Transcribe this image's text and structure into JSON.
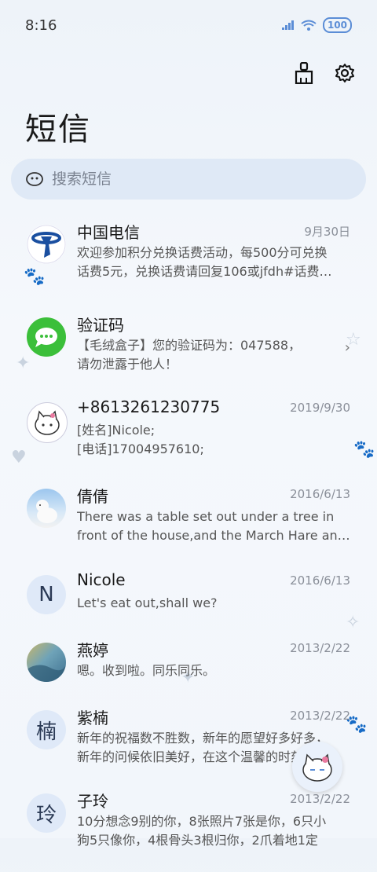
{
  "status_bar": {
    "time": "8:16",
    "battery": "100"
  },
  "header": {
    "title": "短信"
  },
  "search": {
    "placeholder": "搜索短信"
  },
  "conversations": [
    {
      "name": "中国电信",
      "date": "9月30日",
      "line1": "欢迎参加积分兑换话费活动，每500分可兑换",
      "line2": "话费5元，兑换话费请回复106或jfdh#话费…",
      "avatar_icon": "china-telecom-logo"
    },
    {
      "name": "验证码",
      "date": "",
      "line1": "【毛绒盒子】您的验证码为：047588，",
      "line2": "请勿泄露于他人！",
      "avatar_icon": "message-bubble-icon"
    },
    {
      "name": "+8613261230775",
      "date": "2019/9/30",
      "line1": "[姓名]Nicole;",
      "line2": "[电话]17004957610;",
      "avatar_icon": "cat-sticker"
    },
    {
      "name": "倩倩",
      "date": "2016/6/13",
      "line1": "There was a table set out under a tree in",
      "line2": "front of the house,and the March Hare an…",
      "avatar_icon": "polar-bear-photo"
    },
    {
      "name": "Nicole",
      "date": "2016/6/13",
      "line1": "Let's eat out,shall we?",
      "line2": "",
      "avatar_letter": "N"
    },
    {
      "name": "燕婷",
      "date": "2013/2/22",
      "line1": "嗯。收到啦。同乐同乐。",
      "line2": "",
      "avatar_icon": "landscape-photo"
    },
    {
      "name": "紫楠",
      "date": "2013/2/22",
      "line1": "新年的祝福数不胜数，新年的愿望好多好多，",
      "line2": "新年的问候依旧美好，在这个温馨的时刻…",
      "avatar_letter": "楠"
    },
    {
      "name": "子玲",
      "date": "2013/2/22",
      "line1": "10分想念9别的你，8张照片7张是你，6只小",
      "line2": "狗5只像你，4根骨头3根归你，2爪着地1定",
      "avatar_letter": "玲"
    }
  ],
  "colors": {
    "accent": "#5b8dd6",
    "telecom": "#1a4fa0",
    "verify_green": "#3bbf3a"
  }
}
